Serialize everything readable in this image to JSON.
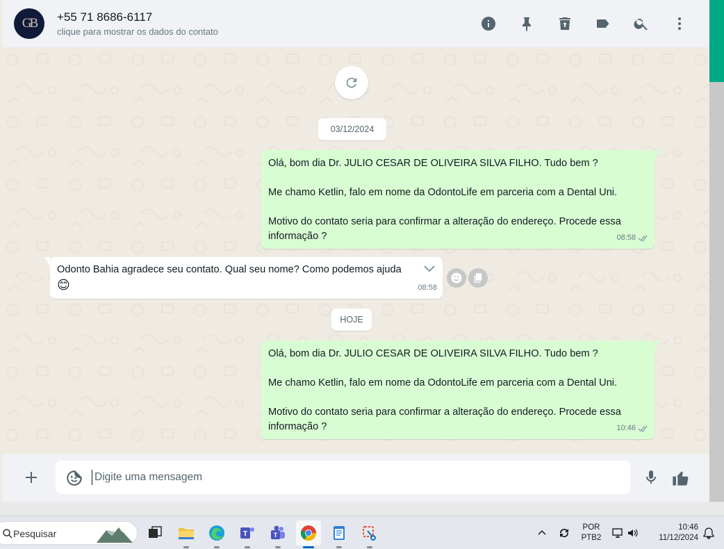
{
  "header": {
    "avatar_initials": "GB",
    "contact_name": "+55 71 8686-6117",
    "contact_subtitle": "clique para mostrar os dados do contato",
    "actions": [
      "info-icon",
      "pin-icon",
      "delete-icon",
      "label-icon",
      "search-icon",
      "menu-icon"
    ]
  },
  "chat": {
    "date_chips": [
      "03/12/2024",
      "HOJE"
    ],
    "messages": [
      {
        "direction": "out",
        "lines": [
          "Olá, bom dia Dr. JULIO CESAR DE OLIVEIRA SILVA FILHO. Tudo bem ?",
          "Me chamo Ketlin, falo em nome da OdontoLife em parceria com a Dental Uni.",
          "Motivo do contato seria para confirmar a alteração do endereço. Procede essa",
          "informação ?"
        ],
        "time": "08:58",
        "status": "read"
      },
      {
        "direction": "in",
        "text": "Odonto Bahia agradece seu contato. Qual seu nome? Como podemos ajuda",
        "emoji": "😊",
        "time": "08:58"
      },
      {
        "direction": "out",
        "lines": [
          "Olá, bom dia Dr. JULIO CESAR DE OLIVEIRA SILVA FILHO. Tudo bem ?",
          "Me chamo Ketlin, falo em nome da OdontoLife em parceria com a Dental Uni.",
          "Motivo do contato seria para confirmar a alteração do endereço. Procede essa",
          "informação ?"
        ],
        "time": "10:46",
        "status": "read"
      }
    ]
  },
  "composer": {
    "placeholder": "Digite uma mensagem"
  },
  "taskbar": {
    "search_placeholder": "Pesquisar",
    "language_top": "POR",
    "language_bottom": "PTB2",
    "clock_time": "10:46",
    "clock_date": "11/12/2024"
  },
  "colors": {
    "outgoing_bubble": "#d9fdd3",
    "incoming_bubble": "#ffffff",
    "accent": "#00a884",
    "chat_bg": "#efeae2"
  }
}
